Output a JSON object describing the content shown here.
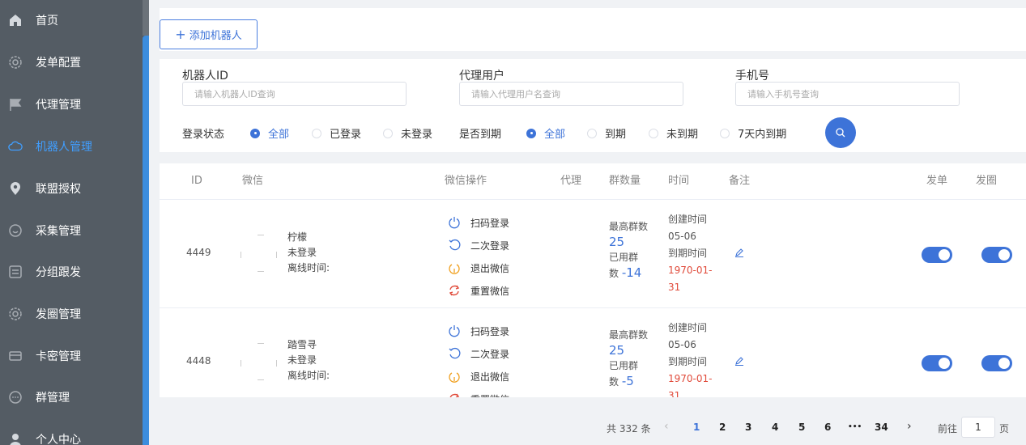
{
  "sidebar": {
    "items": [
      {
        "label": "首页",
        "icon": "home-icon"
      },
      {
        "label": "发单配置",
        "icon": "gear-icon"
      },
      {
        "label": "代理管理",
        "icon": "flag-icon"
      },
      {
        "label": "机器人管理",
        "icon": "cloud-icon",
        "active": true
      },
      {
        "label": "联盟授权",
        "icon": "location-icon"
      },
      {
        "label": "采集管理",
        "icon": "chat-icon"
      },
      {
        "label": "分组跟发",
        "icon": "panel-icon"
      },
      {
        "label": "发圈管理",
        "icon": "gear-icon"
      },
      {
        "label": "卡密管理",
        "icon": "card-icon"
      },
      {
        "label": "群管理",
        "icon": "chat-dots-icon"
      },
      {
        "label": "个人中心",
        "icon": "user-icon"
      }
    ],
    "active_color": "#409eff"
  },
  "toolbar": {
    "add_label": "添加机器人"
  },
  "filters": {
    "robot_id": {
      "label": "机器人ID",
      "placeholder": "请输入机器人ID查询"
    },
    "agent_user": {
      "label": "代理用户",
      "placeholder": "请输入代理用户名查询"
    },
    "phone": {
      "label": "手机号",
      "placeholder": "请输入手机号查询"
    },
    "login_status": {
      "label": "登录状态",
      "options": [
        "全部",
        "已登录",
        "未登录"
      ],
      "selected": "全部"
    },
    "expiry": {
      "label": "是否到期",
      "options": [
        "全部",
        "到期",
        "未到期",
        "7天内到期"
      ],
      "selected": "全部"
    }
  },
  "table": {
    "columns": [
      "ID",
      "微信",
      "微信操作",
      "代理",
      "群数量",
      "时间",
      "备注",
      "发单",
      "发圈"
    ],
    "ops_labels": [
      "扫码登录",
      "二次登录",
      "退出微信",
      "重置微信"
    ],
    "group_labels": {
      "max": "最高群数",
      "used_a": "已用群",
      "used_b": "数"
    },
    "time_labels": {
      "created": "创建时间",
      "expire": "到期时间"
    },
    "rows": [
      {
        "id": "4449",
        "name": "柠檬",
        "status": "未登录",
        "offline": "离线时间:",
        "max_groups": "25",
        "used_groups": "-14",
        "created": "05-06",
        "expire_a": "1970-01-",
        "expire_b": "31",
        "send_on": true,
        "circle_on": true
      },
      {
        "id": "4448",
        "name": "踏雪寻",
        "status": "未登录",
        "offline": "离线时间:",
        "max_groups": "25",
        "used_groups": "-5",
        "created": "05-06",
        "expire_a": "1970-01-",
        "expire_b": "31",
        "send_on": true,
        "circle_on": true
      }
    ]
  },
  "pagination": {
    "total": "共 332 条",
    "pages": [
      "1",
      "2",
      "3",
      "4",
      "5",
      "6",
      "•••",
      "34"
    ],
    "current": "1",
    "goto_label": "前往",
    "goto_value": "1",
    "page_unit": "页"
  },
  "colors": {
    "primary": "#3d73d8",
    "sidebar": "#545c64",
    "danger": "#e04a3a"
  }
}
